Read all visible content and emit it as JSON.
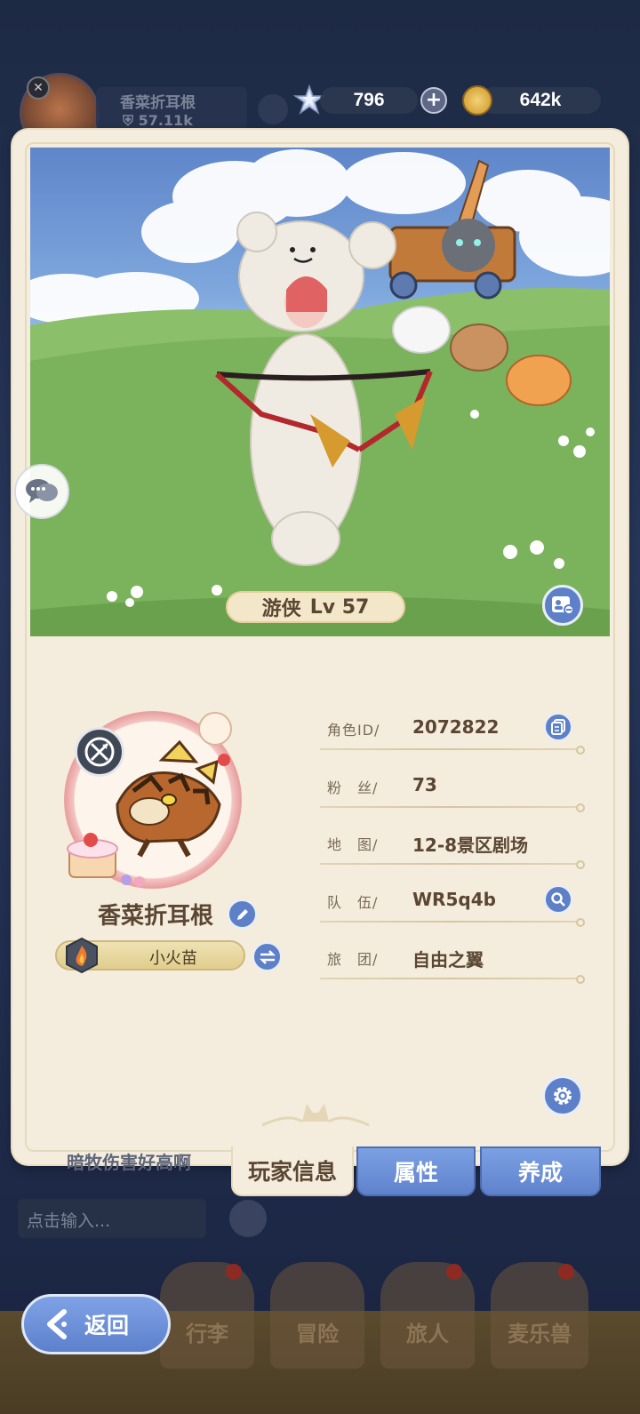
{
  "hud": {
    "bg_player_name": "香菜折耳根",
    "bg_player_power": "57.11k",
    "stars": "796",
    "coins": "642k"
  },
  "scene": {
    "class_name": "游侠",
    "level": "Lv  57"
  },
  "profile": {
    "player_name": "香菜折耳根",
    "title": "小火苗"
  },
  "info": {
    "rows": [
      {
        "label": "角色ID/",
        "value": "2072822",
        "action": "copy-icon"
      },
      {
        "label": "粉　丝/",
        "value": "73"
      },
      {
        "label": "地　图/",
        "value": "12-8景区剧场"
      },
      {
        "label": "队　伍/",
        "value": "WR5q4b",
        "action": "search-icon"
      },
      {
        "label": "旅　团/",
        "value": "自由之翼"
      }
    ]
  },
  "tabs": [
    {
      "label": "玩家信息",
      "active": true
    },
    {
      "label": "属性",
      "active": false
    },
    {
      "label": "养成",
      "active": false
    }
  ],
  "background": {
    "chat_message": "暗牧伤害好高啊",
    "chat_placeholder": "点击输入...",
    "nav": [
      "行李",
      "冒险",
      "旅人",
      "麦乐兽"
    ]
  },
  "back_label": "返回",
  "colors": {
    "accent_blue": "#5d80c9",
    "card_bg": "#f4ecdc",
    "text_brown": "#5a4632"
  }
}
